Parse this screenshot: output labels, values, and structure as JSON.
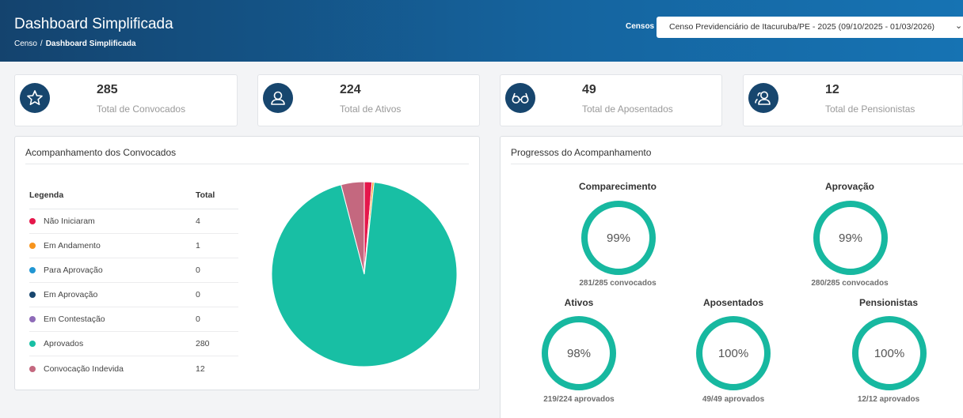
{
  "header": {
    "title": "Dashboard Simplificada",
    "breadcrumb": {
      "root": "Censo",
      "separator": "/",
      "current": "Dashboard Simplificada"
    },
    "censos_label": "Censos",
    "censos_selected": "Censo Previdenciário de Itacuruba/PE - 2025 (09/10/2025 - 01/03/2026)"
  },
  "stats": [
    {
      "value": "285",
      "label": "Total de Convocados",
      "icon": "star-icon"
    },
    {
      "value": "224",
      "label": "Total de Ativos",
      "icon": "user-icon"
    },
    {
      "value": "49",
      "label": "Total de Aposentados",
      "icon": "glasses-icon"
    },
    {
      "value": "12",
      "label": "Total de Pensionistas",
      "icon": "users-icon"
    }
  ],
  "convocados": {
    "title": "Acompanhamento dos Convocados",
    "col_legend": "Legenda",
    "col_total": "Total",
    "rows": [
      {
        "label": "Não Iniciaram",
        "total": "4",
        "color": "#e5174b"
      },
      {
        "label": "Em Andamento",
        "total": "1",
        "color": "#f7941d"
      },
      {
        "label": "Para Aprovação",
        "total": "0",
        "color": "#2196d3"
      },
      {
        "label": "Em Aprovação",
        "total": "0",
        "color": "#17466e"
      },
      {
        "label": "Em Contestação",
        "total": "0",
        "color": "#8e6bb8"
      },
      {
        "label": "Aprovados",
        "total": "280",
        "color": "#18bfa4"
      },
      {
        "label": "Convocação Indevida",
        "total": "12",
        "color": "#c4687f"
      }
    ]
  },
  "progress": {
    "title": "Progressos do Acompanhamento",
    "items": [
      {
        "title": "Comparecimento",
        "percent": "99%",
        "sub": "281/285 convocados"
      },
      {
        "title": "Aprovação",
        "percent": "99%",
        "sub": "280/285 convocados"
      },
      {
        "title": "Ativos",
        "percent": "98%",
        "sub": "219/224 aprovados"
      },
      {
        "title": "Aposentados",
        "percent": "100%",
        "sub": "49/49 aprovados"
      },
      {
        "title": "Pensionistas",
        "percent": "100%",
        "sub": "12/12 aprovados"
      }
    ]
  },
  "colors": {
    "ring": "#17b8a0",
    "header": "#14436e",
    "icon_bg": "#17466e"
  }
}
